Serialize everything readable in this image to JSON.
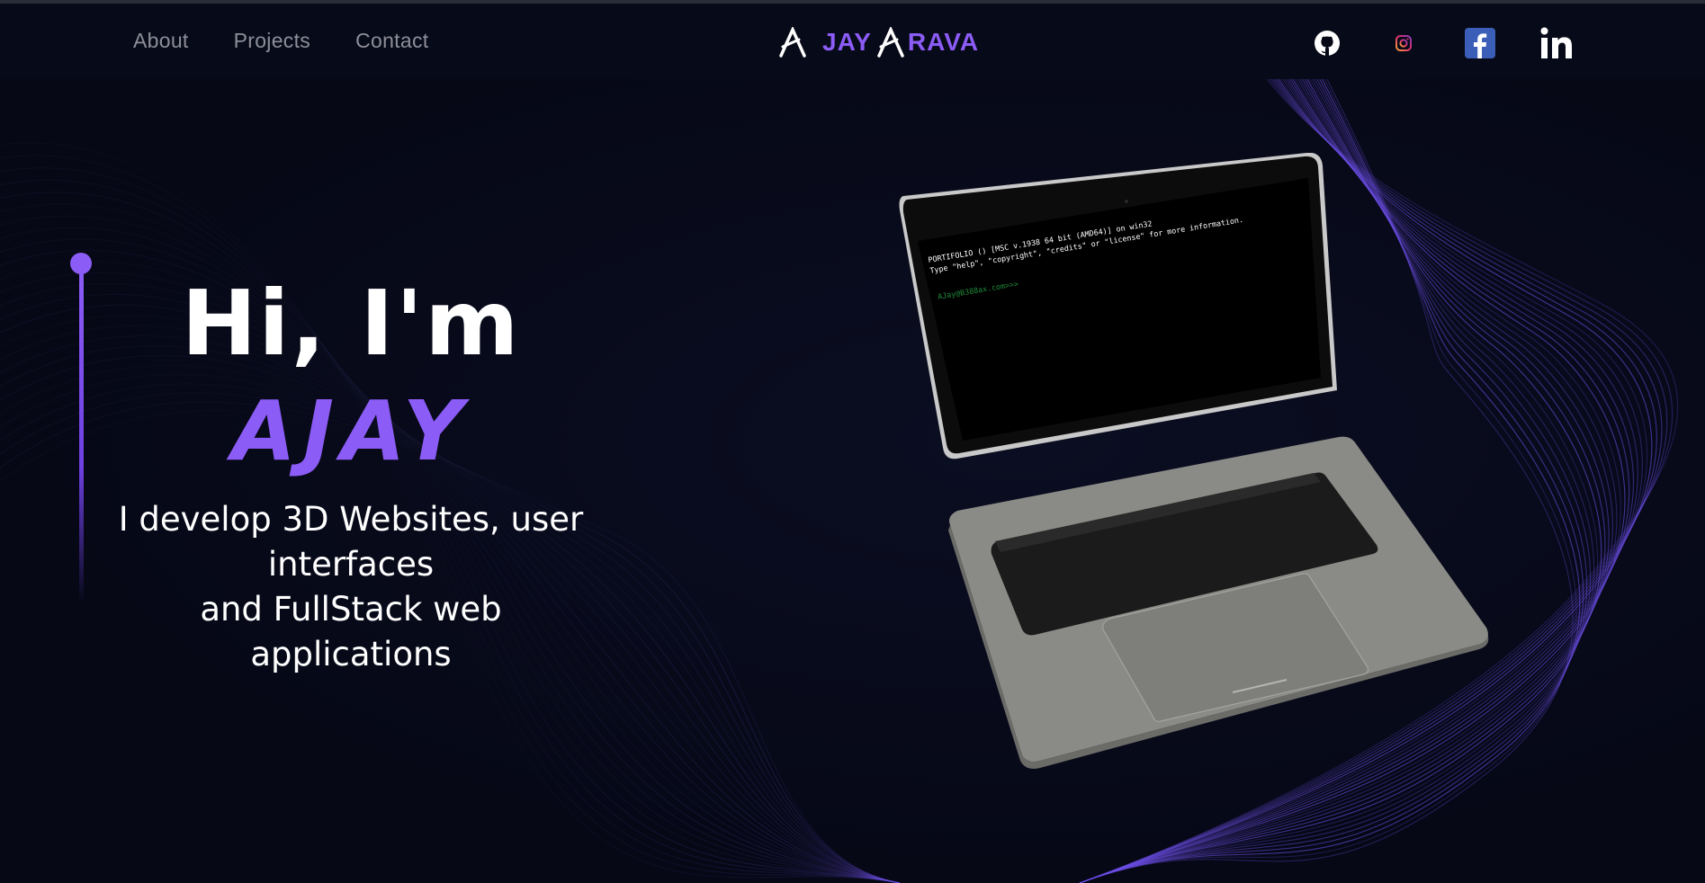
{
  "nav": {
    "links": [
      "About",
      "Projects",
      "Contact"
    ],
    "logo_left": "JAY",
    "logo_right": "RAVA",
    "socials": [
      {
        "name": "github",
        "icon": "github-icon"
      },
      {
        "name": "instagram",
        "icon": "instagram-icon"
      },
      {
        "name": "facebook",
        "icon": "facebook-icon"
      },
      {
        "name": "linkedin",
        "icon": "linkedin-icon"
      }
    ]
  },
  "hero": {
    "greeting": "Hi, I'm",
    "name": "AJAY",
    "description_line1": "I develop 3D Websites, user",
    "description_line2": "interfaces",
    "description_line3": "and FullStack web applications"
  },
  "terminal": {
    "line1": "PORTIFOLIO () [MSC v.1938 64 bit (AMD64)] on win32",
    "line2": "Type \"help\", \"copyright\", \"credits\" or \"license\" for more information.",
    "prompt": "AJay@B388ax.com>>>"
  },
  "colors": {
    "accent": "#8b5cf6",
    "background": "#060816",
    "nav_text": "#8e8e9a"
  }
}
